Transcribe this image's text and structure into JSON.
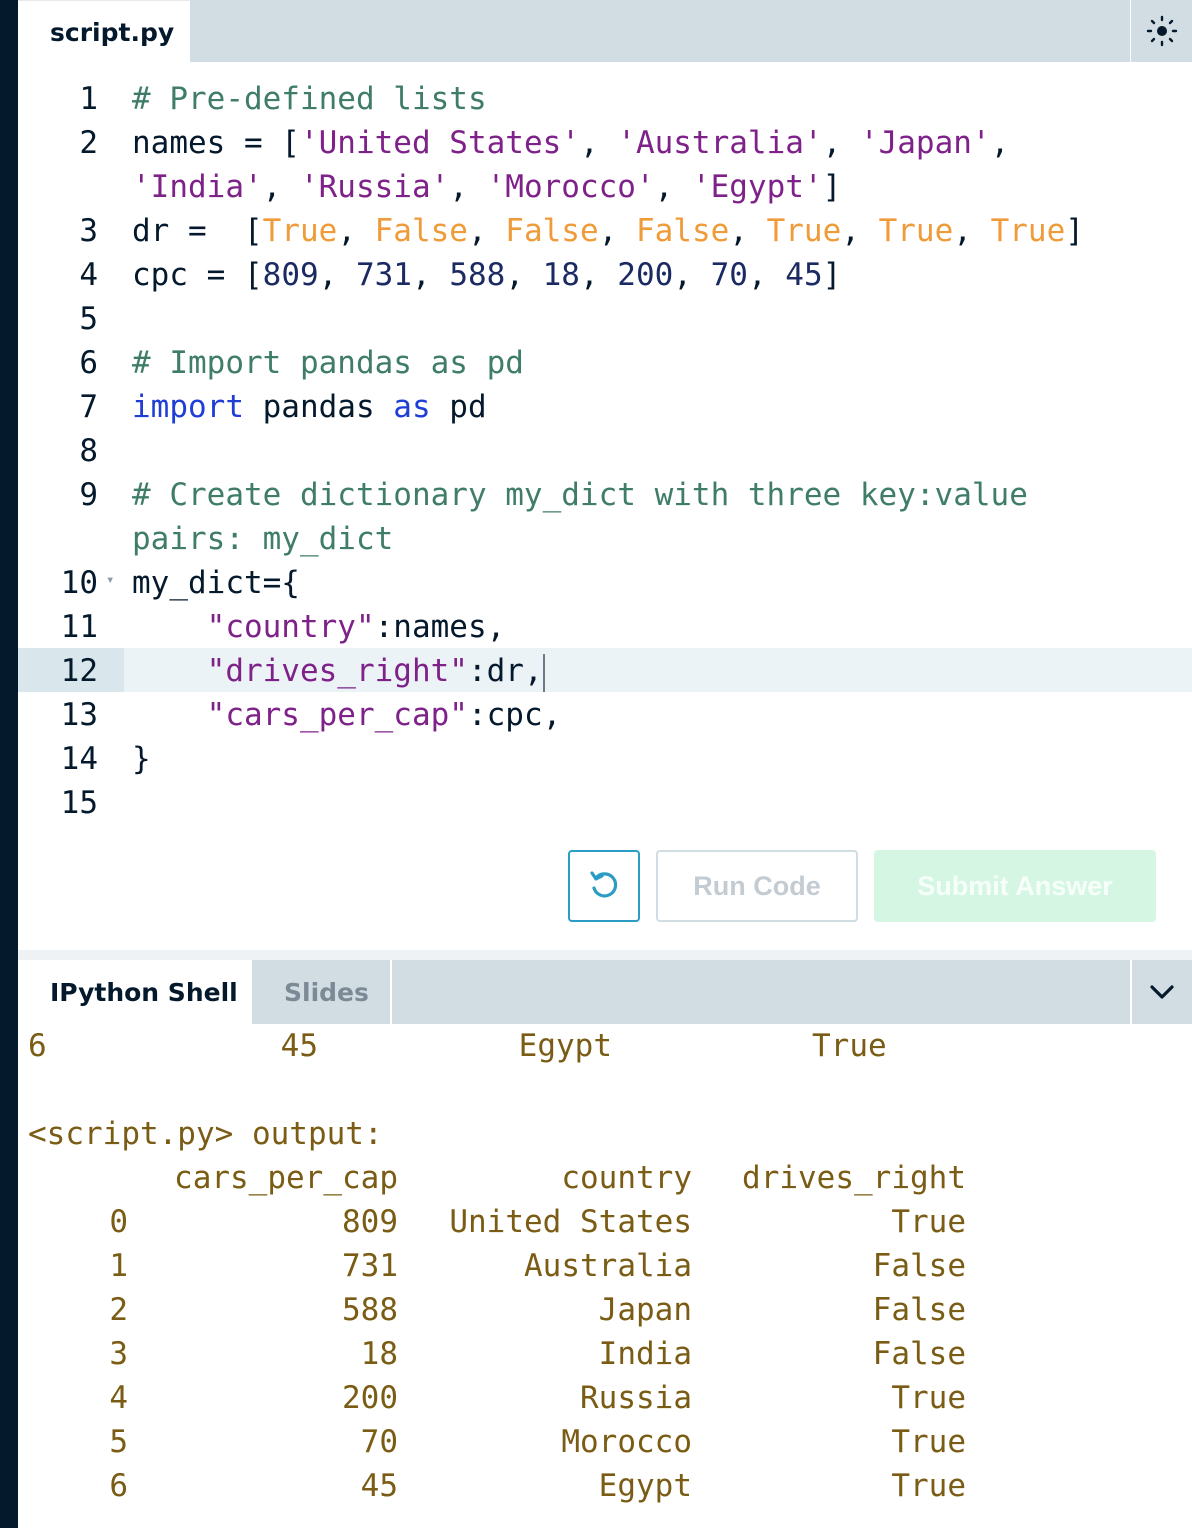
{
  "editor": {
    "tab_label": "script.py",
    "settings_icon": "sun-icon",
    "line_numbers": [
      "1",
      "2",
      "",
      "3",
      "4",
      "5",
      "6",
      "7",
      "8",
      "9",
      "",
      "10",
      "11",
      "12",
      "13",
      "14",
      "15"
    ],
    "lines": {
      "l1": "# Pre-defined lists",
      "l2a": "names = [",
      "l2b": "'United States'",
      "l2c": ", ",
      "l2d": "'Australia'",
      "l2e": ", ",
      "l2f": "'Japan'",
      "l2g": ",",
      "l2h": "'India'",
      "l2i": ", ",
      "l2j": "'Russia'",
      "l2k": ", ",
      "l2l": "'Morocco'",
      "l2m": ", ",
      "l2n": "'Egypt'",
      "l2o": "]",
      "l3a": "dr =  [",
      "l3b": "True",
      "l3c": "False",
      "l3d": "False",
      "l3e": "False",
      "l3f": "True",
      "l3g": "True",
      "l3h": "True",
      "l4a": "cpc = [",
      "l4b": "809",
      "l4c": "731",
      "l4d": "588",
      "l4e": "18",
      "l4f": "200",
      "l4g": "70",
      "l4h": "45",
      "l6": "# Import pandas as pd",
      "l7a": "import",
      "l7b": " pandas ",
      "l7c": "as",
      "l7d": " pd",
      "l9a": "# Create dictionary my_dict with three key:value",
      "l9b": "pairs: my_dict",
      "l10": "my_dict={",
      "l11a": "\"country\"",
      "l11b": ":names,",
      "l12a": "\"drives_right\"",
      "l12b": ":dr,",
      "l13a": "\"cars_per_cap\"",
      "l13b": ":cpc,",
      "l14": "}"
    }
  },
  "buttons": {
    "reset_icon": "reset-icon",
    "run_label": "Run Code",
    "submit_label": "Submit Answer"
  },
  "shell": {
    "tabs": [
      "IPython Shell",
      "Slides"
    ],
    "collapse_icon": "chevron-down-icon",
    "prev_row": [
      "6",
      "45",
      "Egypt",
      "True"
    ],
    "output_label": "<script.py> output:",
    "columns": [
      "cars_per_cap",
      "country",
      "drives_right"
    ],
    "rows": [
      [
        "0",
        "809",
        "United States",
        "True"
      ],
      [
        "1",
        "731",
        "Australia",
        "False"
      ],
      [
        "2",
        "588",
        "Japan",
        "False"
      ],
      [
        "3",
        "18",
        "India",
        "False"
      ],
      [
        "4",
        "200",
        "Russia",
        "True"
      ],
      [
        "5",
        "70",
        "Morocco",
        "True"
      ],
      [
        "6",
        "45",
        "Egypt",
        "True"
      ]
    ]
  }
}
